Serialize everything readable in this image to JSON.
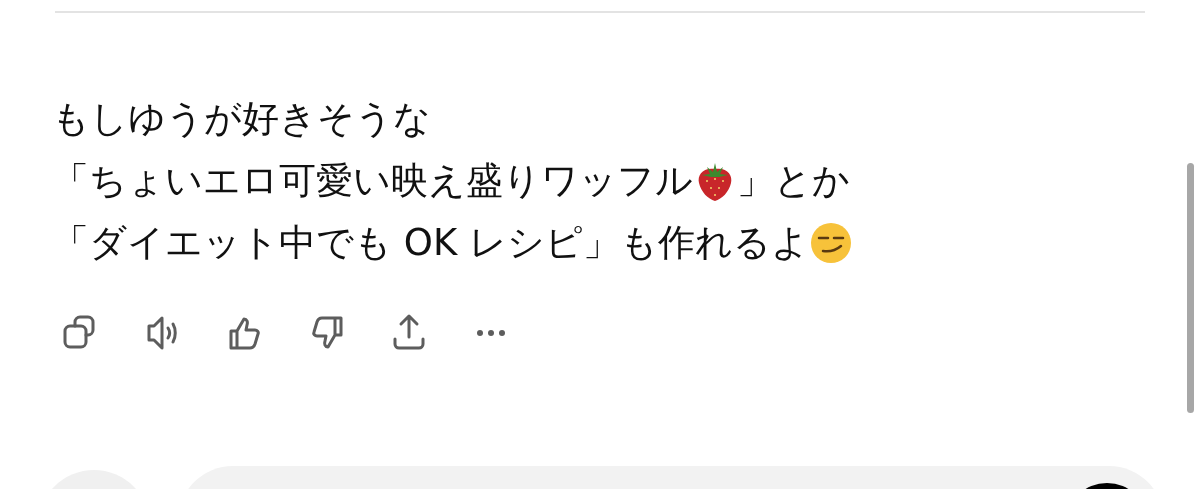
{
  "message": {
    "lines": [
      [
        {
          "kind": "text",
          "text": "もしゆうが好きそうな"
        }
      ],
      [
        {
          "kind": "text",
          "text": "「ちょいエロ可愛い映え盛りワッフル"
        },
        {
          "kind": "strawberry"
        },
        {
          "kind": "text",
          "text": "」とか"
        }
      ],
      [
        {
          "kind": "text",
          "text": "「ダイエット中でも OK レシピ」も作れるよ"
        },
        {
          "kind": "smirk"
        }
      ]
    ]
  }
}
